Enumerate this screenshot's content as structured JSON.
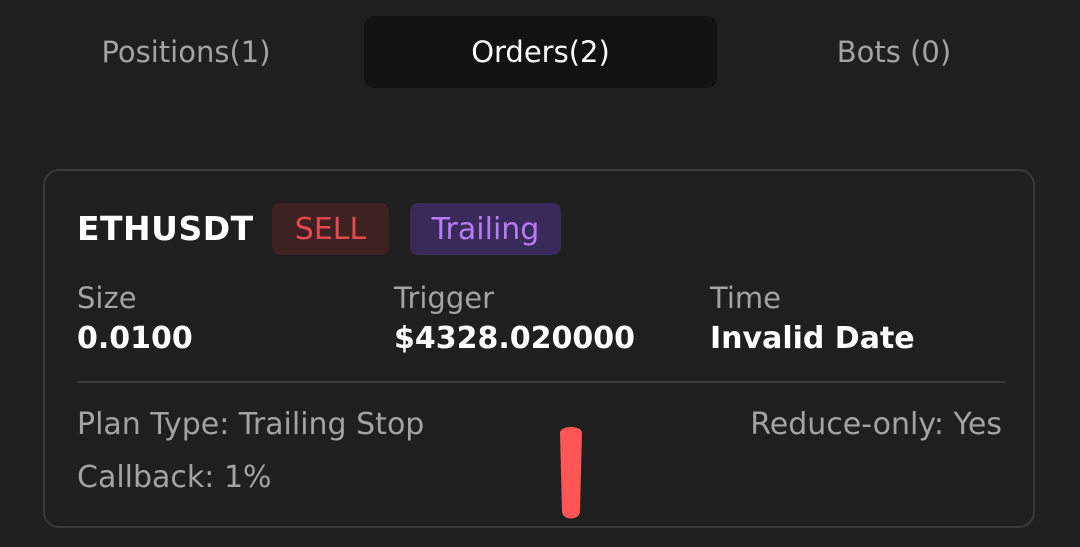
{
  "tabs": [
    {
      "label": "Positions(1)",
      "active": false
    },
    {
      "label": "Orders(2)",
      "active": true
    },
    {
      "label": "Bots (0)",
      "active": false
    }
  ],
  "order": {
    "symbol": "ETHUSDT",
    "side": "SELL",
    "order_type": "Trailing",
    "fields": {
      "size_label": "Size",
      "size_value": "0.0100",
      "trigger_label": "Trigger",
      "trigger_value": "$4328.020000",
      "time_label": "Time",
      "time_value": "Invalid Date"
    },
    "plan_type": "Plan Type: Trailing Stop",
    "reduce_only": "Reduce-only: Yes",
    "callback": "Callback: 1%"
  },
  "colors": {
    "background": "#1f1f1f",
    "active_tab": "#121212",
    "sell": "#e5484d",
    "sell_bg": "#3e2222",
    "trailing": "#b67cf6",
    "trailing_bg": "#3a2a5a",
    "annotation_mark": "#ff5555"
  }
}
